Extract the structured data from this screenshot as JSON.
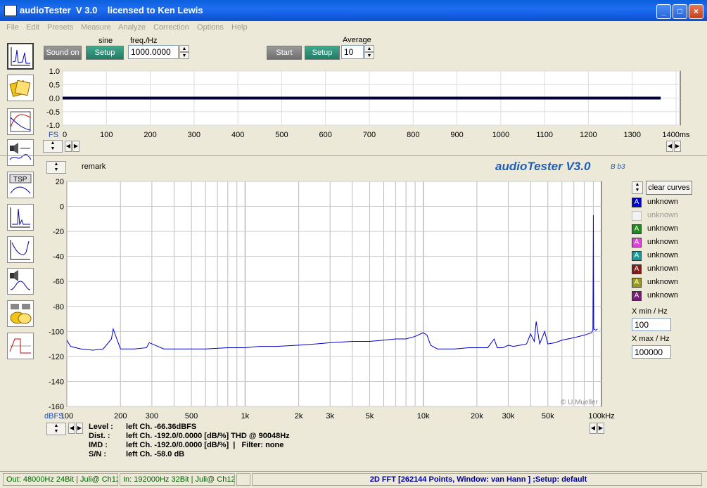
{
  "window": {
    "title": "audioTester  V 3.0    licensed to Ken Lewis",
    "min": "_",
    "max": "□",
    "close": "×"
  },
  "menu": [
    "File",
    "Edit",
    "Presets",
    "Measure",
    "Analyze",
    "Correction",
    "Options",
    "Help"
  ],
  "toolbar": {
    "sound_on": "Sound on",
    "signal_type": "sine",
    "setup1": "Setup",
    "freq_label": "freq./Hz",
    "freq_value": "1000.0000",
    "start": "Start",
    "setup2": "Setup",
    "average_label": "Average",
    "average_value": "10"
  },
  "sidebar": [
    "spectrum-icon",
    "folder-icon",
    "frequency-response-icon",
    "speaker-icon",
    "tsp-icon",
    "impulse-icon",
    "bode-icon",
    "speaker-measure-icon",
    "files-icon",
    "square-wave-icon"
  ],
  "sidebar_tsp_label": "TSP",
  "scope": {
    "fs_label": "FS",
    "y_ticks": [
      "1.0",
      "0.5",
      "0.0",
      "-0.5",
      "-1.0"
    ],
    "x_ticks": [
      "0",
      "100",
      "200",
      "300",
      "400",
      "500",
      "600",
      "700",
      "800",
      "900",
      "1000",
      "1100",
      "1200",
      "1300",
      "1400ms"
    ]
  },
  "fft": {
    "remark": "remark",
    "brand": "audioTester V3.0",
    "brand_build": "B b3",
    "copyright": "© U.Mueller",
    "y_unit": "dBFS",
    "y_ticks": [
      "20",
      "0",
      "-20",
      "-40",
      "-60",
      "-80",
      "-100",
      "-120",
      "-140",
      "-160"
    ],
    "x_ticks": [
      "100",
      "200",
      "300",
      "500",
      "1k",
      "2k",
      "3k",
      "5k",
      "10k",
      "20k",
      "30k",
      "50k",
      "100kHz"
    ]
  },
  "legend": {
    "clear": "clear curves",
    "items": [
      {
        "letter": "A",
        "label": "unknown",
        "color": "#0000cc",
        "enabled": true
      },
      {
        "letter": "",
        "label": "unknown",
        "color": "#f2f2f2",
        "enabled": false
      },
      {
        "letter": "A",
        "label": "unknown",
        "color": "#1a8a1a",
        "enabled": true
      },
      {
        "letter": "A",
        "label": "unknown",
        "color": "#e040e0",
        "enabled": true
      },
      {
        "letter": "A",
        "label": "unknown",
        "color": "#1a9a9a",
        "enabled": true
      },
      {
        "letter": "A",
        "label": "unknown",
        "color": "#8a1a1a",
        "enabled": true
      },
      {
        "letter": "A",
        "label": "unknown",
        "color": "#9a9a1a",
        "enabled": true
      },
      {
        "letter": "A",
        "label": "unknown",
        "color": "#7a1a7a",
        "enabled": true
      }
    ],
    "xmin_label": "X min / Hz",
    "xmin_value": "100",
    "xmax_label": "X max / Hz",
    "xmax_value": "100000"
  },
  "info": {
    "level_label": "Level :",
    "level_value": "left Ch. -66.36dBFS",
    "dist_label": "Dist. :",
    "dist_value": "left Ch. -192.0/0.0000 [dB/%] THD @ 90048Hz",
    "imd_label": "IMD :",
    "imd_value": "left Ch. -192.0/0.0000 [dB/%]  |   Filter: none",
    "sn_label": "S/N :",
    "sn_value": "left Ch. -58.0 dB"
  },
  "status": {
    "out": "Out: 48000Hz 24Bit  | Juli@ Ch12",
    "in": "In: 192000Hz 32Bit  | Juli@ Ch12",
    "fft": "2D FFT [262144 Points, Window: van Hann ] ;Setup:  default"
  },
  "chart_data": [
    {
      "type": "line",
      "title": "",
      "xlabel": "",
      "ylabel": "FS",
      "xlim": [
        0,
        1400
      ],
      "ylim": [
        -1.0,
        1.0
      ],
      "series": [
        {
          "x": [
            0,
            1365
          ],
          "y": [
            0.0,
            0.0
          ]
        }
      ]
    },
    {
      "type": "line",
      "title": "",
      "xscale": "log",
      "ylabel": "dBFS",
      "xlim": [
        100,
        100000
      ],
      "ylim": [
        -160,
        20
      ],
      "series": [
        {
          "x": [
            100,
            105,
            120,
            140,
            160,
            178,
            182,
            200,
            240,
            280,
            290,
            350,
            400,
            500,
            600,
            800,
            1000,
            1200,
            1500,
            2000,
            2500,
            3000,
            4000,
            5000,
            6000,
            7000,
            8000,
            9000,
            10000,
            10500,
            11000,
            12000,
            15000,
            18000,
            20000,
            23000,
            25000,
            26000,
            28000,
            30000,
            32000,
            35000,
            38000,
            40000,
            42000,
            43000,
            45000,
            48000,
            50000,
            55000,
            60000,
            70000,
            80000,
            88000,
            89500,
            90048,
            90500,
            93000,
            95000
          ],
          "y": [
            -107,
            -112,
            -114,
            -115,
            -114,
            -106,
            -98,
            -114,
            -114,
            -113,
            -109,
            -114,
            -114,
            -114,
            -114,
            -113,
            -113,
            -112,
            -112,
            -111,
            -110,
            -109,
            -108,
            -108,
            -107,
            -106,
            -106,
            -104,
            -101,
            -103,
            -111,
            -114,
            -114,
            -113,
            -113,
            -113,
            -106,
            -113,
            -113,
            -111,
            -112,
            -111,
            -110,
            -102,
            -108,
            -92,
            -110,
            -100,
            -110,
            -109,
            -107,
            -105,
            -103,
            -101,
            -99,
            -7,
            -98,
            -99,
            -98
          ]
        }
      ]
    }
  ]
}
